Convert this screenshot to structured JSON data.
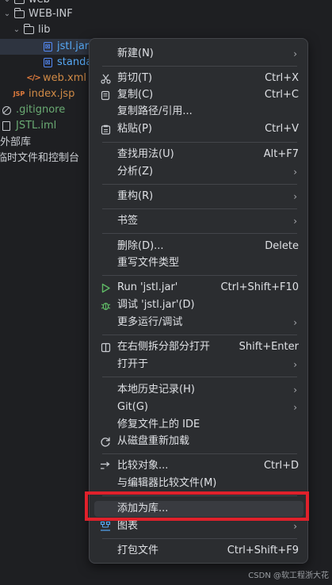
{
  "tree": {
    "web": "web",
    "webinf": "WEB-INF",
    "lib": "lib",
    "jstl_jar": "jstl.jar",
    "standard_jar": "standa",
    "web_xml": "web.xml",
    "index_jsp": "index.jsp",
    "gitignore": ".gitignore",
    "jstl_iml": "JSTL.iml",
    "external_libs": "外部库",
    "scratches": "临时文件和控制台"
  },
  "menu": {
    "new": "新建(N)",
    "cut": "剪切(T)",
    "cut_sc": "Ctrl+X",
    "copy": "复制(C)",
    "copy_sc": "Ctrl+C",
    "copy_path": "复制路径/引用...",
    "paste": "粘贴(P)",
    "paste_sc": "Ctrl+V",
    "find_usages": "查找用法(U)",
    "find_usages_sc": "Alt+F7",
    "analyze": "分析(Z)",
    "refactor": "重构(R)",
    "bookmarks": "书签",
    "delete": "删除(D)...",
    "delete_sc": "Delete",
    "override_type": "重写文件类型",
    "run": "Run 'jstl.jar'",
    "run_sc": "Ctrl+Shift+F10",
    "debug": "调试 'jstl.jar'(D)",
    "more_run": "更多运行/调试",
    "open_split": "在右侧拆分部分打开",
    "open_split_sc": "Shift+Enter",
    "open_in": "打开于",
    "local_history": "本地历史记录(H)",
    "git": "Git(G)",
    "repair_ide": "修复文件上的 IDE",
    "reload": "从磁盘重新加载",
    "compare_with": "比较对象...",
    "compare_with_sc": "Ctrl+D",
    "compare_editor": "与编辑器比较文件(M)",
    "add_as_library": "添加为库...",
    "diagrams": "图表",
    "package_file": "打包文件",
    "package_file_sc": "Ctrl+Shift+F9"
  },
  "watermark": "CSDN @软工程浙大花",
  "colors": {
    "background": "#1e1f22",
    "menu_bg": "#2b2d30",
    "highlight_bg": "#393b40",
    "annotation_red": "#e0212b",
    "run_green": "#5fb865",
    "jar_blue": "#548af7"
  }
}
